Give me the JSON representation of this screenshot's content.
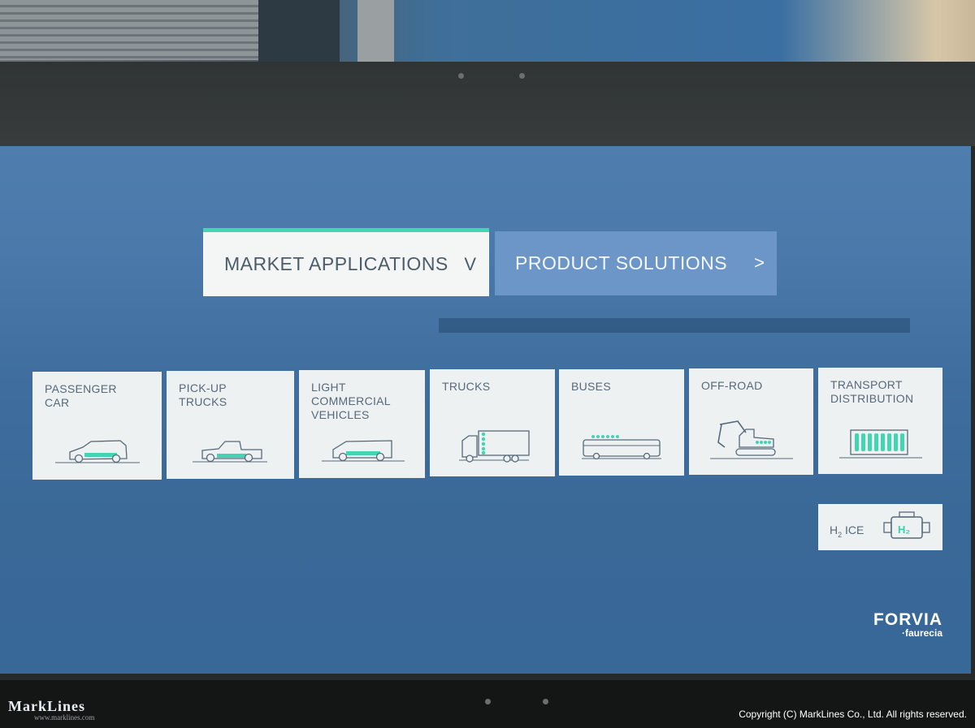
{
  "header": {
    "market_applications": "MARKET APPLICATIONS",
    "market_chevron": "V",
    "product_solutions": "PRODUCT SOLUTIONS",
    "product_chevron": ">"
  },
  "tiles": [
    {
      "label": "PASSENGER\nCAR",
      "icon": "passenger-car-icon"
    },
    {
      "label": "PICK-UP\nTRUCKS",
      "icon": "pickup-truck-icon"
    },
    {
      "label": "LIGHT\nCOMMERCIAL\nVEHICLES",
      "icon": "van-icon"
    },
    {
      "label": "TRUCKS",
      "icon": "truck-icon"
    },
    {
      "label": "BUSES",
      "icon": "bus-icon"
    },
    {
      "label": "OFF-ROAD",
      "icon": "excavator-icon"
    },
    {
      "label": "TRANSPORT\nDISTRIBUTION",
      "icon": "container-icon"
    }
  ],
  "h2_ice": {
    "label_main": "H",
    "label_sub": "2",
    "label_rest": " ICE",
    "badge": "H₂",
    "icon": "engine-icon"
  },
  "logo": {
    "main": "FORVIA",
    "sub": "·faurecia"
  },
  "watermark": {
    "main": "MarkLines",
    "url": "www.marklines.com"
  },
  "copyright": "Copyright (C) MarkLines Co., Ltd. All rights reserved.",
  "colors": {
    "accent": "#42d4b3",
    "screen": "#4a79aa",
    "tile": "#eef1f2",
    "text": "#56697b"
  }
}
